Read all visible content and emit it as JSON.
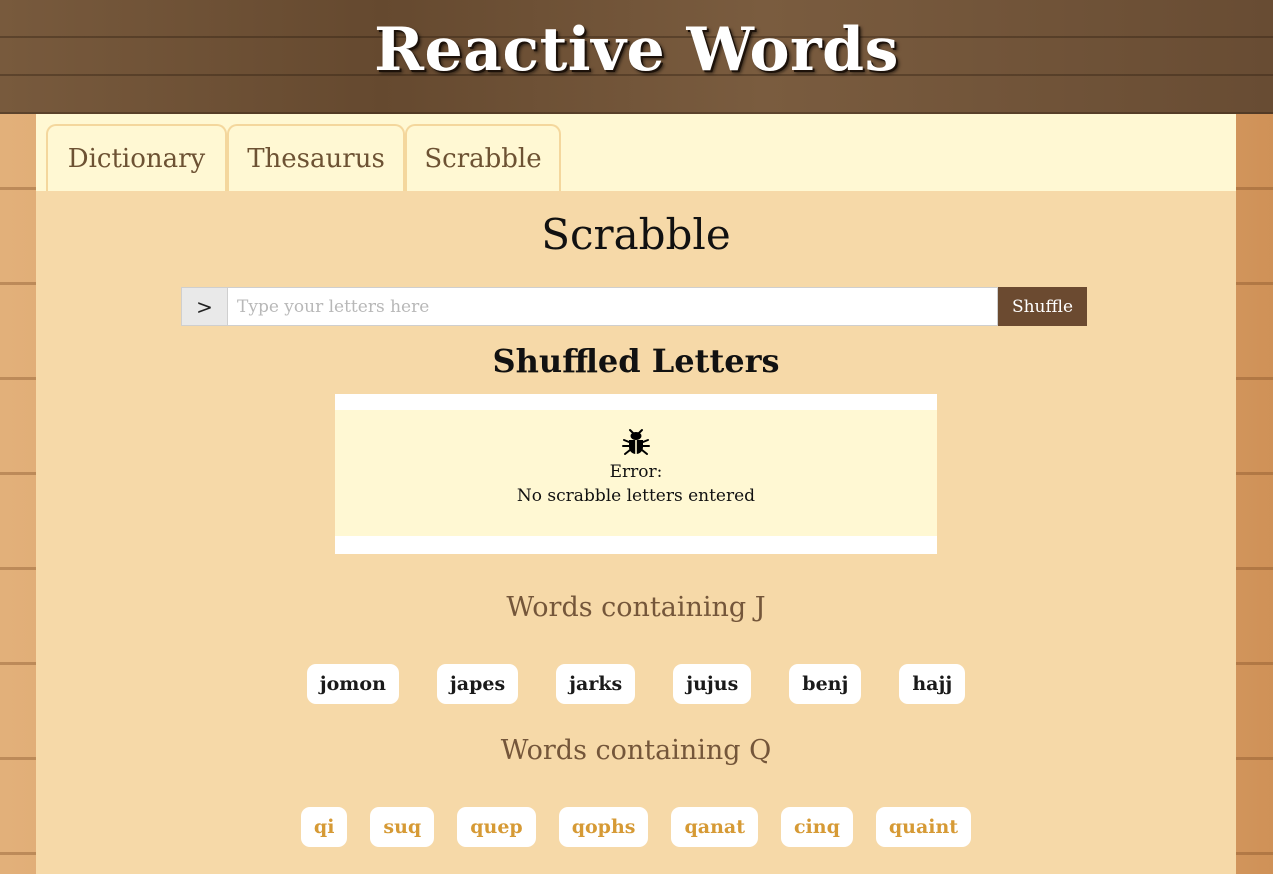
{
  "header": {
    "title": "Reactive Words"
  },
  "tabs": [
    {
      "label": "Dictionary"
    },
    {
      "label": "Thesaurus"
    },
    {
      "label": "Scrabble"
    }
  ],
  "main": {
    "title": "Scrabble",
    "search": {
      "prompt": ">",
      "placeholder": "Type your letters here",
      "value": "",
      "button_label": "Shuffle"
    },
    "shuffled_title": "Shuffled Letters",
    "error": {
      "icon": "bug-icon",
      "label": "Error:",
      "message": "No scrabble letters entered"
    },
    "sections": [
      {
        "title": "Words containing J",
        "words": [
          "jomon",
          "japes",
          "jarks",
          "jujus",
          "benj",
          "hajj"
        ]
      },
      {
        "title": "Words containing Q",
        "words": [
          "qi",
          "suq",
          "quep",
          "qophs",
          "qanat",
          "cinq",
          "quaint"
        ]
      }
    ]
  },
  "colors": {
    "header_wood": "#6f5338",
    "panel": "#f6d9a8",
    "tab_bg": "#fff8d3",
    "button": "#6b4a30",
    "q_word": "#d69a35",
    "section_title": "#74563a"
  }
}
